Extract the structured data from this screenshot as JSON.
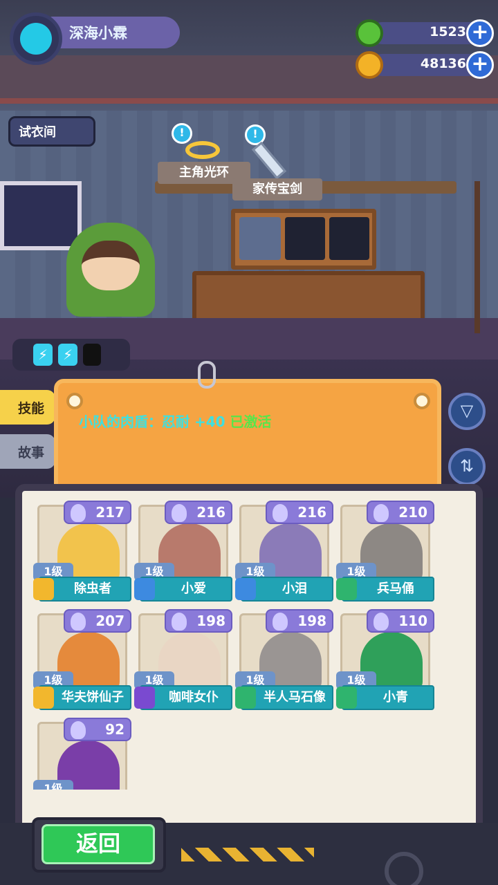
{
  "player": {
    "name": "深海小霖",
    "avatar_icon": "cat-face-icon"
  },
  "currencies": [
    {
      "icon": "green-gem-icon",
      "value": "1523",
      "color": "#59c23a"
    },
    {
      "icon": "gold-planet-coin-icon",
      "value": "48136",
      "color": "#f3b227"
    }
  ],
  "fitting_room": {
    "label": "试衣间"
  },
  "equipment": [
    {
      "label": "主角光环",
      "icon": "halo-icon"
    },
    {
      "label": "家传宝剑",
      "icon": "sword-icon"
    }
  ],
  "side_tabs": [
    {
      "label": "技能",
      "active": true
    },
    {
      "label": "故事",
      "active": false
    }
  ],
  "skill_board": {
    "text_main": "小队的肉盾：忍耐 +40",
    "text_status": "已激活"
  },
  "characters": [
    {
      "power": "217",
      "level": "1级",
      "name": "除虫者",
      "rank": "gold",
      "color": "#f2c34c"
    },
    {
      "power": "216",
      "level": "1级",
      "name": "小爱",
      "rank": "blue",
      "color": "#b87a6c"
    },
    {
      "power": "216",
      "level": "1级",
      "name": "小泪",
      "rank": "blue",
      "color": "#8b7bb8"
    },
    {
      "power": "210",
      "level": "1级",
      "name": "兵马俑",
      "rank": "green",
      "color": "#8d8884"
    },
    {
      "power": "207",
      "level": "1级",
      "name": "华夫饼仙子",
      "rank": "gold",
      "color": "#e58a3c"
    },
    {
      "power": "198",
      "level": "1级",
      "name": "咖啡女仆",
      "rank": "purple",
      "color": "#e9d6c4"
    },
    {
      "power": "198",
      "level": "1级",
      "name": "半人马石像",
      "rank": "green",
      "color": "#9a9593"
    },
    {
      "power": "110",
      "level": "1级",
      "name": "小青",
      "rank": "green",
      "color": "#2fa05a"
    },
    {
      "power": "92",
      "level": "1级",
      "name": "",
      "rank": "purple",
      "color": "#7a3ea8"
    }
  ],
  "back_button": {
    "label": "返回"
  },
  "colors": {
    "gold": "#f2b72d",
    "blue": "#3d8ae0",
    "green": "#2fb46e",
    "purple": "#7a4ad0"
  }
}
